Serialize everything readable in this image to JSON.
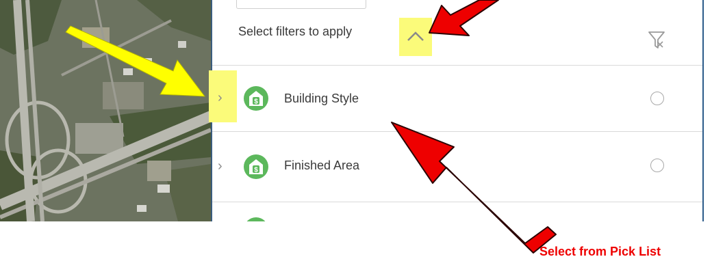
{
  "map": {
    "icon": "aerial-map"
  },
  "panel": {
    "header": "Select filters to apply",
    "collapse_icon": "chevron-up-icon",
    "filter_icon": "filter-icon"
  },
  "filters": [
    {
      "label": "Building Style",
      "icon": "house-dollar-icon",
      "selected": false
    },
    {
      "label": "Finished Area",
      "icon": "house-dollar-icon",
      "selected": false
    }
  ],
  "annotation": {
    "callout": "Select from Pick List"
  },
  "colors": {
    "highlight": "#fbfb7a",
    "icon_green": "#5cb85c",
    "arrow_red": "#ee0000",
    "arrow_yellow": "#ffff00"
  }
}
